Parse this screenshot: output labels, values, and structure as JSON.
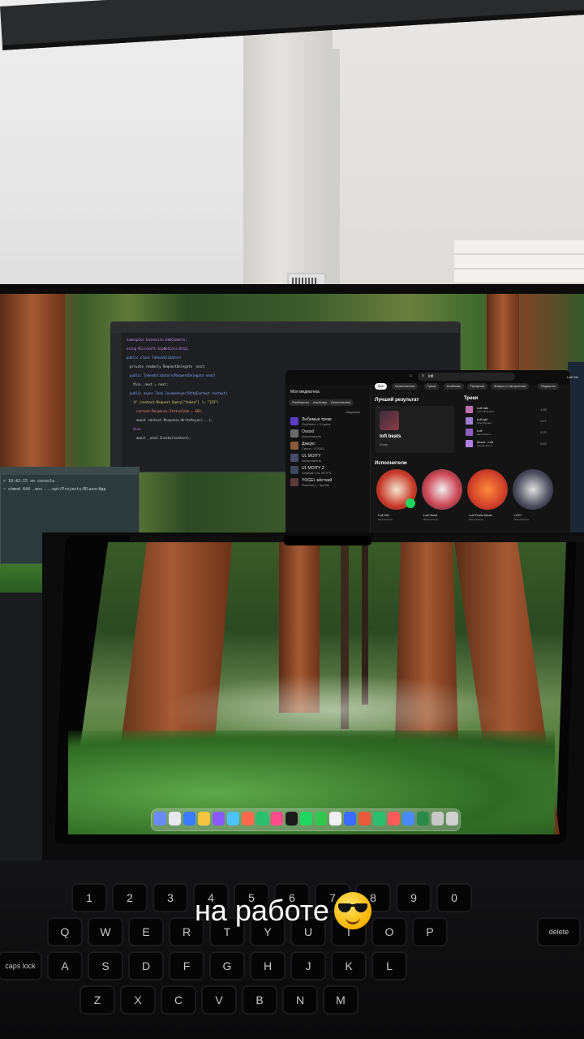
{
  "caption": {
    "text": "на работе",
    "emoji": "smiling-face-with-sunglasses"
  },
  "ide": {
    "code_lines": [
      "namespace Extension.OkdComents;",
      "using Microsoft.AspNetCore.Http;",
      "public class TokenValidators",
      "  private readonly RequestDelegate _next;",
      "  public TokenValidators(RequestDelegate next)",
      "    this._next = next;",
      "  public async Task InvokeAsync(HttpContext context)",
      "    if (context.Request.Query[\"token\"] != \"123\")",
      "      context.Response.StatusCode = 403;",
      "      await context.Response.WriteAsync(...);",
      "    else",
      "      await _next.Invoke(context);"
    ]
  },
  "terminal": {
    "lines": [
      "> 10:42:15 on console",
      "~ chmod 644 .env ...opt/Projects/BlazorApp"
    ]
  },
  "music": {
    "search": "lofi",
    "chips": [
      "Все",
      "Исполнители",
      "Треки",
      "Альбомы",
      "Профили",
      "Жанры и настроения",
      "Подкасты"
    ],
    "sidebar_title": "Моя медиатека",
    "sidebar_filters": [
      "Плейлисты",
      "Альбомы",
      "Исполнители"
    ],
    "sidebar_recent": "Недавние",
    "sidebar_items": [
      {
        "title": "Любимые треки",
        "sub": "Плейлист • 3 трека"
      },
      {
        "title": "Oxxxxl",
        "sub": "Исполнитель"
      },
      {
        "title": "Джизус",
        "sub": "Сингл • YOGEL"
      },
      {
        "title": "UL MOITY",
        "sub": "Исполнитель"
      },
      {
        "title": "UL MOITY 2",
        "sub": "Альбом • UL MOITY"
      },
      {
        "title": "YOGEL жёсткий",
        "sub": "Плейлист • Spotify"
      }
    ],
    "top_result_label": "Лучший результат",
    "top_result_title": "lofi beats",
    "top_result_sub": "Жанр",
    "tracks_label": "Треки",
    "tracks": [
      {
        "title": "Lofi rain",
        "artist": "Lofi Chill & Rain",
        "time": "1:45"
      },
      {
        "title": "Lofi girl",
        "artist": "Этар Буриал",
        "time": "2:47"
      },
      {
        "title": "Lofi",
        "artist": "Экстазиасты",
        "time": "2:22"
      },
      {
        "title": "Mood - Lofi",
        "artist": "Vaughn Mood",
        "time": "2:42"
      }
    ],
    "artists_label": "Исполнители",
    "artists": [
      {
        "name": "Lofi Girl",
        "sub": "Исполнитель"
      },
      {
        "name": "Lofi Victor",
        "sub": "Исполнитель"
      },
      {
        "name": "Lofi Fruits Music",
        "sub": "Исполнитель"
      },
      {
        "name": "LOFI",
        "sub": "Исполнитель"
      }
    ],
    "right_panel_title": "Lofi Girl"
  },
  "keyboard": {
    "row1": [
      "1",
      "2",
      "3",
      "4",
      "5",
      "6",
      "7",
      "8",
      "9",
      "0"
    ],
    "row2": [
      "Q",
      "W",
      "E",
      "R",
      "T",
      "Y",
      "U",
      "I",
      "O",
      "P"
    ],
    "row3": [
      "A",
      "S",
      "D",
      "F",
      "G",
      "H",
      "J",
      "K",
      "L"
    ],
    "row4": [
      "Z",
      "X",
      "C",
      "V",
      "B",
      "N",
      "M"
    ],
    "special_left": "caps lock",
    "special_right": "delete"
  },
  "colors": {
    "music_bg": "#141414",
    "accent_green": "#1ed760",
    "ide_bg": "#1e1f22"
  }
}
